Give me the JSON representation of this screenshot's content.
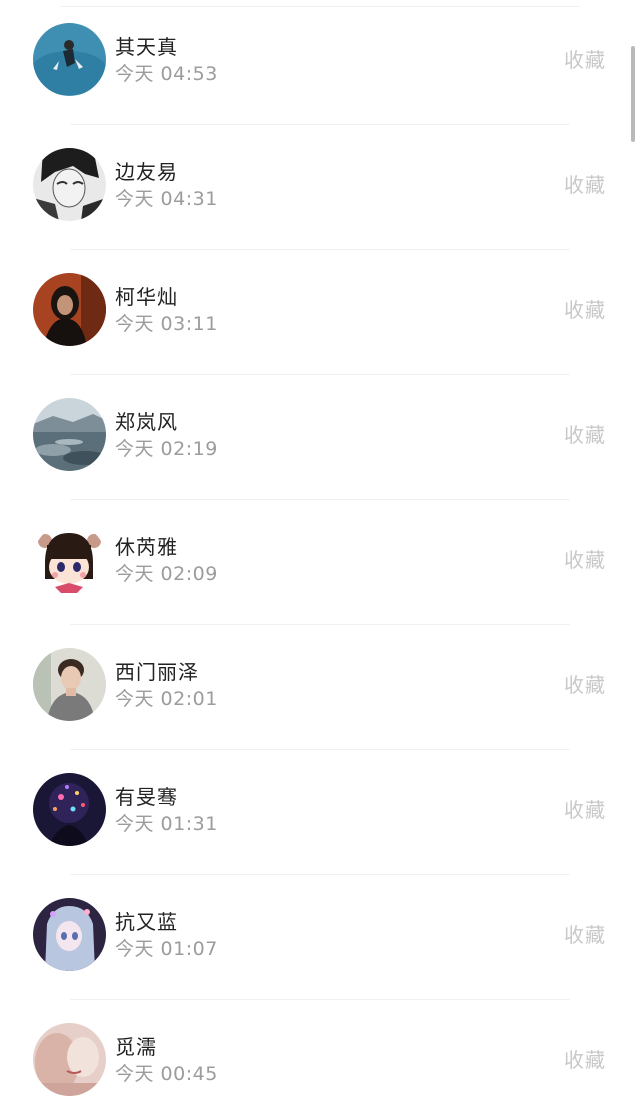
{
  "action_label": "收藏",
  "contacts": [
    {
      "name": "其天真",
      "time": "今天 04:53",
      "avatar": "water-scene-avatar"
    },
    {
      "name": "边友易",
      "time": "今天 04:31",
      "avatar": "ink-sketch-avatar"
    },
    {
      "name": "柯华灿",
      "time": "今天 03:11",
      "avatar": "portrait-red-background-avatar"
    },
    {
      "name": "郑岚风",
      "time": "今天 02:19",
      "avatar": "lake-landscape-avatar"
    },
    {
      "name": "休芮雅",
      "time": "今天 02:09",
      "avatar": "cartoon-girl-avatar"
    },
    {
      "name": "西门丽泽",
      "time": "今天 02:01",
      "avatar": "young-man-avatar"
    },
    {
      "name": "有旻骞",
      "time": "今天 01:31",
      "avatar": "fireworks-avatar"
    },
    {
      "name": "抗又蓝",
      "time": "今天 01:07",
      "avatar": "anime-girl-avatar"
    },
    {
      "name": "觅濡",
      "time": "今天 00:45",
      "avatar": "soft-portrait-avatar"
    }
  ],
  "colors": {
    "name_text": "#222222",
    "time_text": "#9c9c9c",
    "action_text": "#c8c8c8",
    "divider": "#f1f1f1"
  }
}
